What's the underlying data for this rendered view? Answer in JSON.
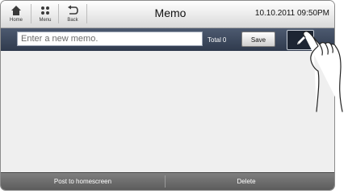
{
  "nav": {
    "home_label": "Home",
    "menu_label": "Menu",
    "back_label": "Back"
  },
  "header": {
    "title": "Memo",
    "datetime": "10.10.2011 09:50PM"
  },
  "toolbar": {
    "input_placeholder": "Enter a new memo.",
    "input_value": "",
    "total_label": "Total",
    "total_count": "0",
    "save_label": "Save"
  },
  "footer": {
    "post_label": "Post to homescreen",
    "delete_label": "Delete"
  },
  "icons": {
    "home": "home-icon",
    "menu": "menu-grid-icon",
    "back": "back-arrow-icon",
    "edit": "pen-icon"
  }
}
